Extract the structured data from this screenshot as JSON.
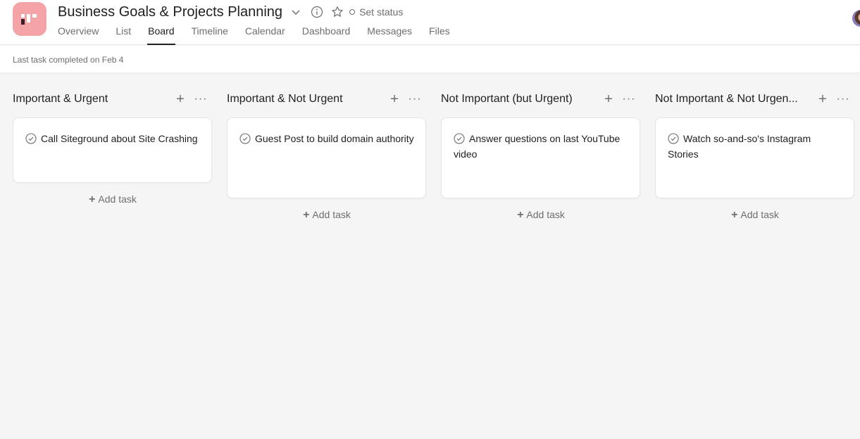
{
  "project": {
    "title": "Business Goals & Projects Planning",
    "icon": "project-board-icon",
    "icon_color": "#f4a3a6",
    "set_status_label": "Set status"
  },
  "tabs": [
    {
      "label": "Overview",
      "active": false
    },
    {
      "label": "List",
      "active": false
    },
    {
      "label": "Board",
      "active": true
    },
    {
      "label": "Timeline",
      "active": false
    },
    {
      "label": "Calendar",
      "active": false
    },
    {
      "label": "Dashboard",
      "active": false
    },
    {
      "label": "Messages",
      "active": false
    },
    {
      "label": "Files",
      "active": false
    }
  ],
  "subbar": {
    "note": "Last task completed on Feb 4"
  },
  "board": {
    "add_task_label": "Add task",
    "columns": [
      {
        "title": "Important & Urgent",
        "tasks": [
          {
            "name": "Call Siteground about Site Crashing"
          }
        ]
      },
      {
        "title": "Important & Not Urgent",
        "tasks": [
          {
            "name": "Guest Post to build domain authority"
          }
        ]
      },
      {
        "title": "Not Important (but Urgent)",
        "tasks": [
          {
            "name": "Answer questions on last YouTube video"
          }
        ]
      },
      {
        "title": "Not Important & Not Urgen...",
        "tasks": [
          {
            "name": "Watch so-and-so's Instagram Stories"
          }
        ]
      }
    ]
  }
}
